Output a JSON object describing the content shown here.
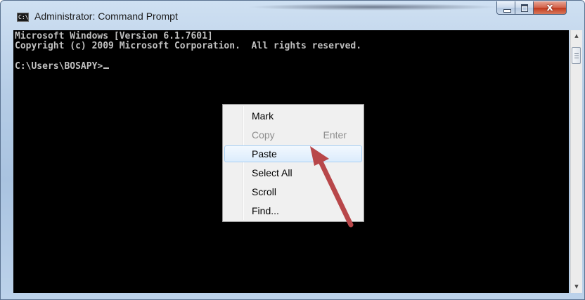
{
  "window": {
    "title": "Administrator: Command Prompt",
    "icon_text": "C:\\",
    "icons": {
      "app": "command-prompt-icon",
      "minimize": "minimize-icon",
      "maximize": "maximize-icon",
      "close": "close-icon"
    },
    "close_glyph": "x"
  },
  "console": {
    "lines": [
      "Microsoft Windows [Version 6.1.7601]",
      "Copyright (c) 2009 Microsoft Corporation.  All rights reserved.",
      "",
      "C:\\Users\\BOSAPY>"
    ],
    "text_color": "#c0c0c0",
    "background_color": "#000000"
  },
  "scrollbar": {
    "up_arrow": "▲",
    "down_arrow": "▼",
    "position": 0
  },
  "context_menu": {
    "items": [
      {
        "label": "Mark",
        "shortcut": "",
        "enabled": true,
        "highlighted": false
      },
      {
        "label": "Copy",
        "shortcut": "Enter",
        "enabled": false,
        "highlighted": false
      },
      {
        "label": "Paste",
        "shortcut": "",
        "enabled": true,
        "highlighted": true
      },
      {
        "label": "Select All",
        "shortcut": "",
        "enabled": true,
        "highlighted": false
      },
      {
        "label": "Scroll",
        "shortcut": "",
        "enabled": true,
        "highlighted": false
      },
      {
        "label": "Find...",
        "shortcut": "",
        "enabled": true,
        "highlighted": false
      }
    ]
  },
  "annotation": {
    "arrow_color": "#b8474a"
  }
}
